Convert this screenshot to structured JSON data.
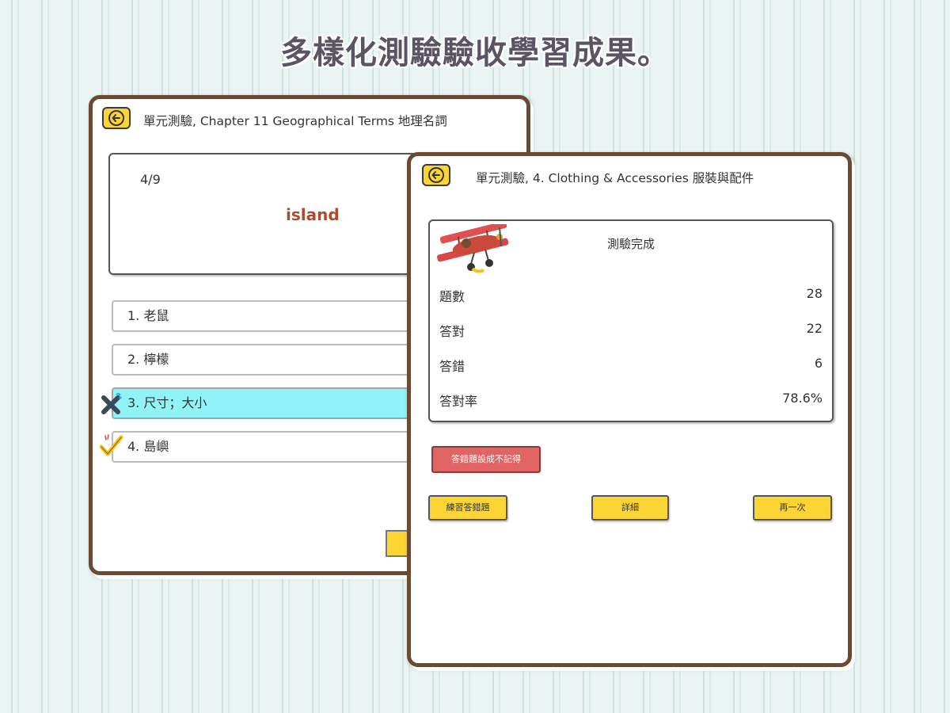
{
  "headline": "多樣化測驗驗收學習成果。",
  "quiz_panel": {
    "title": "單元測驗, Chapter 11 Geographical Terms 地理名詞",
    "counter": "4/9",
    "word": "island",
    "options": [
      {
        "label": "1. 老鼠",
        "state": "normal"
      },
      {
        "label": "2. 檸檬",
        "state": "normal"
      },
      {
        "label": "3. 尺寸；大小",
        "state": "wrong"
      },
      {
        "label": "4. 島嶼",
        "state": "correct"
      }
    ]
  },
  "result_panel": {
    "title": "單元測驗, 4. Clothing & Accessories 服裝與配件",
    "result_title": "測驗完成",
    "stats": [
      {
        "label": "題數",
        "value": "28"
      },
      {
        "label": "答對",
        "value": "22"
      },
      {
        "label": "答錯",
        "value": "6"
      },
      {
        "label": "答對率",
        "value": "78.6%"
      }
    ],
    "reset_button": "答錯題設成不記得",
    "practice_button": "練習答錯題",
    "detail_button": "詳細",
    "again_button": "再一次"
  },
  "colors": {
    "frame": "#6b4a34",
    "accent_yellow": "#fcd535",
    "selected_option": "#8ff3f8",
    "word": "#b04a2c",
    "danger": "#e06464"
  },
  "icons": {
    "back": "arrow-left-icon",
    "wrong": "cross-icon",
    "correct": "check-icon",
    "illustration": "biplane-icon"
  }
}
